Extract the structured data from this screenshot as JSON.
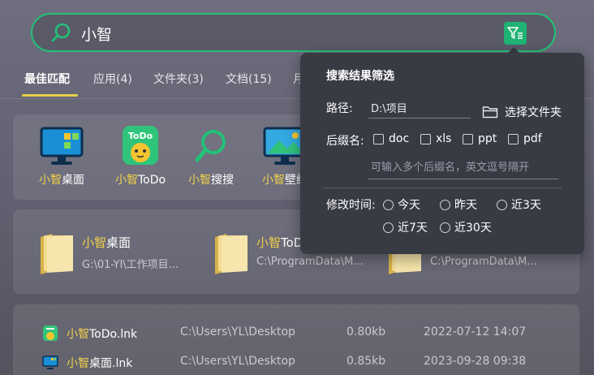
{
  "search": {
    "query": "小智"
  },
  "tabs": [
    {
      "label": "最佳匹配"
    },
    {
      "label": "应用(4)"
    },
    {
      "label": "文件夹(3)"
    },
    {
      "label": "文档(15)"
    },
    {
      "label": "月"
    }
  ],
  "apps": [
    {
      "hl": "小智",
      "rest": "桌面",
      "icon": "monitor-icon"
    },
    {
      "hl": "小智",
      "rest": "ToDo",
      "icon": "todo-app-icon"
    },
    {
      "hl": "小智",
      "rest": "搜搜",
      "icon": "search-app-icon"
    },
    {
      "hl": "小智",
      "rest": "壁纸",
      "icon": "wallpaper-app-icon"
    }
  ],
  "folders": [
    {
      "hl": "小智",
      "rest": "桌面",
      "path": "G:\\01-YI\\工作项目..."
    },
    {
      "hl": "小智",
      "rest": "ToDo",
      "path": "C:\\ProgramData\\M..."
    },
    {
      "hl": "",
      "rest": "",
      "path": "C:\\ProgramData\\M..."
    }
  ],
  "files": [
    {
      "hl": "小智",
      "rest": "ToDo.lnk",
      "path": "C:\\Users\\YL\\Desktop",
      "size": "0.80kb",
      "date": "2022-07-12 14:07",
      "icon": "todo-app-icon"
    },
    {
      "hl": "小智",
      "rest": "桌面.lnk",
      "path": "C:\\Users\\YL\\Desktop",
      "size": "0.85kb",
      "date": "2023-09-28 09:38",
      "icon": "monitor-icon"
    }
  ],
  "filter": {
    "title": "搜索结果筛选",
    "path_label": "路径:",
    "path_value": "D:\\项目",
    "choose_folder": "选择文件夹",
    "suffix_label": "后缀名:",
    "suffixes": [
      "doc",
      "xls",
      "ppt",
      "pdf"
    ],
    "suffix_placeholder": "可输入多个后缀名，英文逗号隔开",
    "time_label": "修改时间:",
    "times": [
      "今天",
      "昨天",
      "近3天",
      "近7天",
      "近30天"
    ]
  },
  "colors": {
    "accent": "#22c178",
    "highlight": "#f2d24a",
    "popup_bg": "#383a44"
  }
}
